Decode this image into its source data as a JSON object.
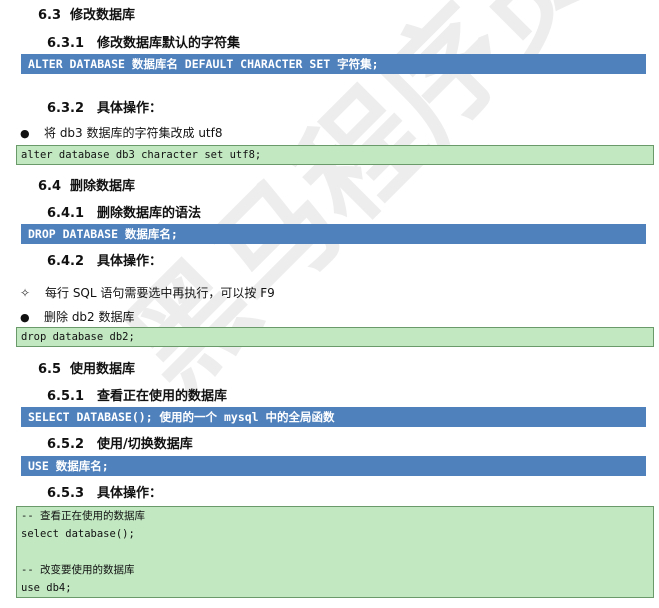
{
  "watermark": "黑马程序员JavaEE学院",
  "s63": {
    "num": "6.3",
    "title": "修改数据库"
  },
  "s631": {
    "num": "6.3.1",
    "title": "修改数据库默认的字符集"
  },
  "bar1": "ALTER DATABASE 数据库名 DEFAULT CHARACTER SET 字符集;",
  "s632": {
    "num": "6.3.2",
    "title": "具体操作："
  },
  "bullet1": "将 db3 数据库的字符集改成 utf8",
  "code1": [
    "alter database db3 character set utf8;"
  ],
  "s64": {
    "num": "6.4",
    "title": "删除数据库"
  },
  "s641": {
    "num": "6.4.1",
    "title": "删除数据库的语法"
  },
  "bar2": "DROP DATABASE 数据库名;",
  "s642": {
    "num": "6.4.2",
    "title": "具体操作："
  },
  "tip": {
    "symbol": "✧",
    "text": "每行 SQL 语句需要选中再执行，可以按 F9"
  },
  "bullet2": "删除 db2 数据库",
  "code2": [
    "drop database db2;"
  ],
  "s65": {
    "num": "6.5",
    "title": "使用数据库"
  },
  "s651": {
    "num": "6.5.1",
    "title": "查看正在使用的数据库"
  },
  "bar3": "SELECT DATABASE();  使用的一个 mysql 中的全局函数",
  "s652": {
    "num": "6.5.2",
    "title": "使用/切换数据库"
  },
  "bar4": "USE 数据库名;",
  "s653": {
    "num": "6.5.3",
    "title": "具体操作："
  },
  "code3": [
    "-- 查看正在使用的数据库",
    "select database();",
    "",
    "-- 改变要使用的数据库",
    "use db4;"
  ]
}
